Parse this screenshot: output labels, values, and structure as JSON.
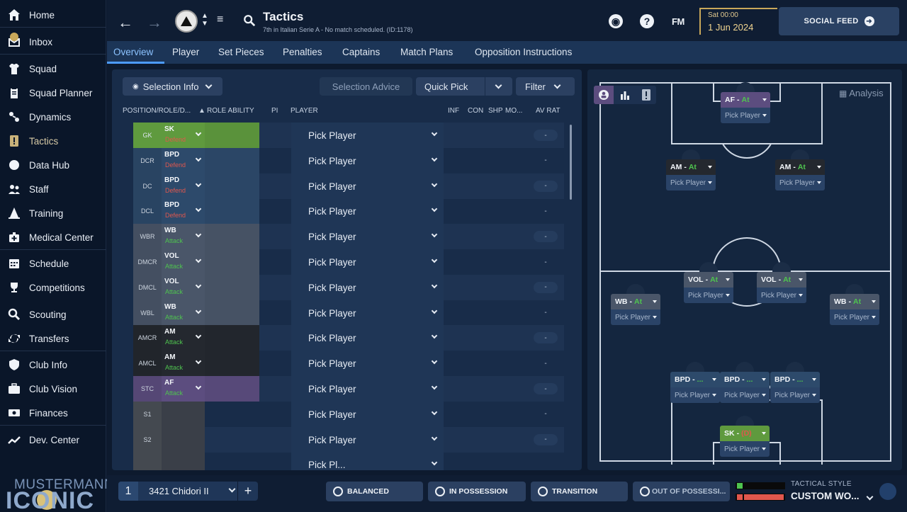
{
  "sidebar": {
    "items": [
      {
        "label": "Home",
        "icon": "home-icon"
      },
      {
        "label": "Inbox",
        "icon": "inbox-icon"
      },
      {
        "label": "Squad",
        "icon": "shirt-icon"
      },
      {
        "label": "Squad Planner",
        "icon": "clipboard-icon"
      },
      {
        "label": "Dynamics",
        "icon": "dynamics-icon"
      },
      {
        "label": "Tactics",
        "icon": "tactics-board-icon",
        "active": true
      },
      {
        "label": "Data Hub",
        "icon": "data-hub-icon"
      },
      {
        "label": "Staff",
        "icon": "staff-icon"
      },
      {
        "label": "Training",
        "icon": "cone-icon"
      },
      {
        "label": "Medical Center",
        "icon": "medical-kit-icon"
      },
      {
        "label": "Schedule",
        "icon": "calendar-icon"
      },
      {
        "label": "Competitions",
        "icon": "trophy-icon"
      },
      {
        "label": "Scouting",
        "icon": "magnifier-icon"
      },
      {
        "label": "Transfers",
        "icon": "transfer-arrows-icon"
      },
      {
        "label": "Club Info",
        "icon": "shield-icon"
      },
      {
        "label": "Club Vision",
        "icon": "briefcase-icon"
      },
      {
        "label": "Finances",
        "icon": "money-icon"
      },
      {
        "label": "Dev. Center",
        "icon": "trend-icon"
      }
    ],
    "brand_top": "MUSTERMANN",
    "brand_bottom": "ICONIC"
  },
  "topbar": {
    "title": "Tactics",
    "subtitle": "7th in Italian Serie A - No match scheduled. (ID:1178)",
    "fm_label": "FM",
    "help_label": "?",
    "date_day": "Sat 00:00",
    "date_main": "1 Jun 2024",
    "social_label": "SOCIAL FEED"
  },
  "subnav": {
    "tabs": [
      "Overview",
      "Player",
      "Set Pieces",
      "Penalties",
      "Captains",
      "Match Plans",
      "Opposition Instructions"
    ]
  },
  "left_panel": {
    "selection_info": "Selection Info",
    "selection_advice": "Selection Advice",
    "quick_pick": "Quick Pick",
    "filter": "Filter",
    "columns": {
      "position": "POSITION/ROLE/D...",
      "role_ability": "ROLE ABILITY",
      "pi": "PI",
      "player": "PLAYER",
      "inf": "INF",
      "con": "CON",
      "shp": "SHP",
      "mo": "MO...",
      "avrat": "AV RAT"
    },
    "rows": [
      {
        "pos": "GK",
        "role": "SK",
        "duty": "Defend",
        "player": "Pick Player",
        "avr": "-",
        "group": "gk"
      },
      {
        "pos": "DCR",
        "role": "BPD",
        "duty": "Defend",
        "player": "Pick Player",
        "avr": "-",
        "group": "def"
      },
      {
        "pos": "DC",
        "role": "BPD",
        "duty": "Defend",
        "player": "Pick Player",
        "avr": "-",
        "group": "def"
      },
      {
        "pos": "DCL",
        "role": "BPD",
        "duty": "Defend",
        "player": "Pick Player",
        "avr": "-",
        "group": "def"
      },
      {
        "pos": "WBR",
        "role": "WB",
        "duty": "Attack",
        "player": "Pick Player",
        "avr": "-",
        "group": "mid"
      },
      {
        "pos": "DMCR",
        "role": "VOL",
        "duty": "Attack",
        "player": "Pick Player",
        "avr": "-",
        "group": "mid"
      },
      {
        "pos": "DMCL",
        "role": "VOL",
        "duty": "Attack",
        "player": "Pick Player",
        "avr": "-",
        "group": "mid"
      },
      {
        "pos": "WBL",
        "role": "WB",
        "duty": "Attack",
        "player": "Pick Player",
        "avr": "-",
        "group": "mid"
      },
      {
        "pos": "AMCR",
        "role": "AM",
        "duty": "Attack",
        "player": "Pick Player",
        "avr": "-",
        "group": "am"
      },
      {
        "pos": "AMCL",
        "role": "AM",
        "duty": "Attack",
        "player": "Pick Player",
        "avr": "-",
        "group": "am"
      },
      {
        "pos": "STC",
        "role": "AF",
        "duty": "Attack",
        "player": "Pick Player",
        "avr": "-",
        "group": "st"
      },
      {
        "pos": "S1",
        "role": "",
        "duty": "",
        "player": "Pick Player",
        "avr": "-",
        "group": "sub"
      },
      {
        "pos": "S2",
        "role": "",
        "duty": "",
        "player": "Pick Player",
        "avr": "-",
        "group": "sub"
      },
      {
        "pos": "",
        "role": "",
        "duty": "",
        "player": "Pick Pl...",
        "avr": "",
        "group": "sub"
      }
    ]
  },
  "pitch": {
    "analysis_label": "Analysis",
    "slots": [
      {
        "role": "AF",
        "duty": "At",
        "pick": "Pick Player",
        "group": "st"
      },
      {
        "role": "AM",
        "duty": "At",
        "pick": "Pick Player",
        "group": "am"
      },
      {
        "role": "AM",
        "duty": "At",
        "pick": "Pick Player",
        "group": "am"
      },
      {
        "role": "VOL",
        "duty": "At",
        "pick": "Pick Player",
        "group": "mid"
      },
      {
        "role": "VOL",
        "duty": "At",
        "pick": "Pick Player",
        "group": "mid"
      },
      {
        "role": "WB",
        "duty": "At",
        "pick": "Pick Player",
        "group": "mid"
      },
      {
        "role": "WB",
        "duty": "At",
        "pick": "Pick Player",
        "group": "mid"
      },
      {
        "role": "BPD",
        "duty": "...",
        "pick": "Pick Player",
        "group": "def"
      },
      {
        "role": "BPD",
        "duty": "...",
        "pick": "Pick Player",
        "group": "def"
      },
      {
        "role": "BPD",
        "duty": "...",
        "pick": "Pick Player",
        "group": "def"
      },
      {
        "role": "SK",
        "duty": "(D)",
        "pick": "Pick Player",
        "group": "gk"
      }
    ]
  },
  "bottombar": {
    "formation_number": "1",
    "formation_name": "3421 Chidori II",
    "plus": "+",
    "phases": [
      "BALANCED",
      "IN POSSESSION",
      "TRANSITION",
      "OUT OF POSSESSI..."
    ],
    "style_label": "TACTICAL STYLE",
    "style_value": "CUSTOM WO..."
  },
  "colors": {
    "gk": "#5f9a3e",
    "def": "#2d4a6b",
    "mid": "#4a5669",
    "am": "#24282f",
    "st": "#5c4d7f",
    "sub": "#3a3f48",
    "defend": "#e0574d",
    "attack": "#4fc44f",
    "accent": "#4d9bff"
  }
}
